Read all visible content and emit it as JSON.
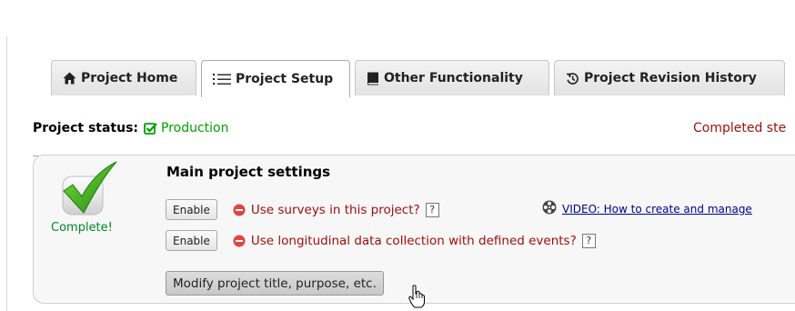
{
  "tabs": [
    {
      "label": "Project Home",
      "icon": "home-icon",
      "active": false
    },
    {
      "label": "Project Setup",
      "icon": "list-icon",
      "active": true
    },
    {
      "label": "Other Functionality",
      "icon": "book-icon",
      "active": false
    },
    {
      "label": "Project Revision History",
      "icon": "history-icon",
      "active": false
    }
  ],
  "status": {
    "label": "Project status:",
    "value": "Production",
    "value_color": "#00a000"
  },
  "completed_steps": "Completed ste",
  "panel": {
    "complete_label": "Complete!",
    "title": "Main project settings",
    "options": [
      {
        "button": "Enable",
        "text": "Use surveys in this project?",
        "help": "?"
      },
      {
        "button": "Enable",
        "text": "Use longitudinal data collection with defined events?",
        "help": "?"
      }
    ],
    "video_link": "VIDEO: How to create and manage",
    "modify_button": "Modify project title, purpose, etc."
  },
  "colors": {
    "option_text": "#a00d0d",
    "complete_text": "#00852b",
    "link": "#00008b",
    "check_green": "#3aa61a"
  }
}
